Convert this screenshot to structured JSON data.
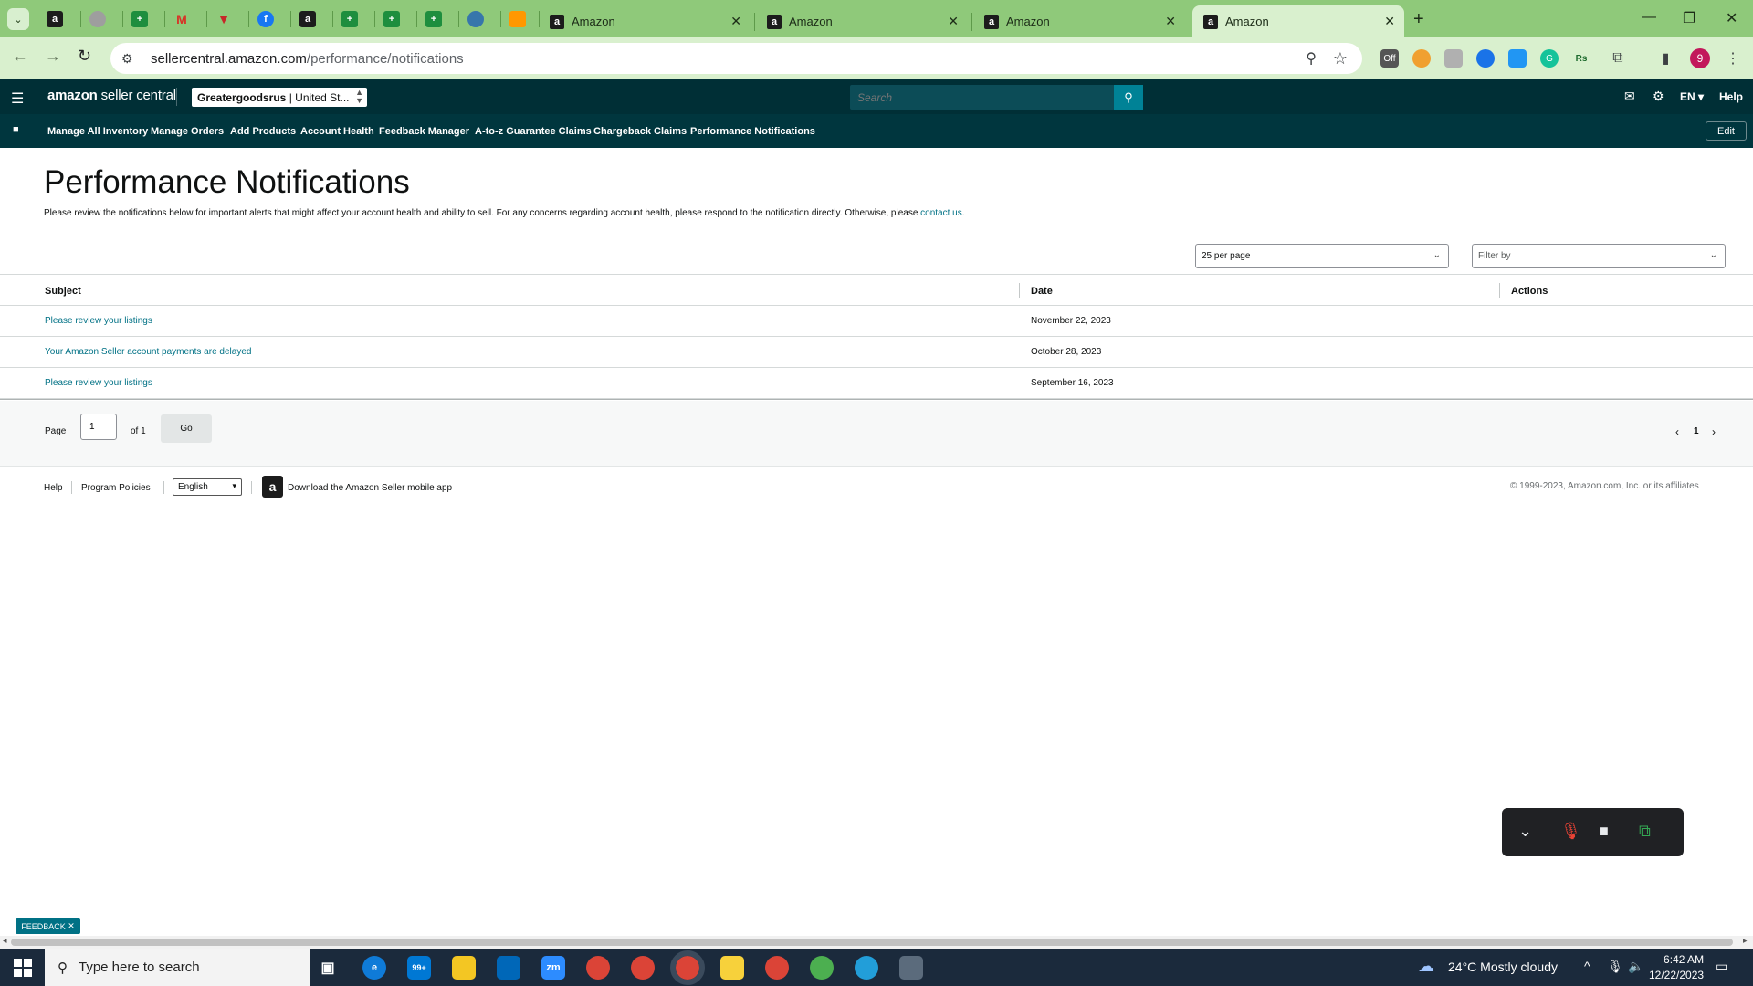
{
  "browser": {
    "tabs": [
      {
        "title": "Amazon"
      },
      {
        "title": "Amazon"
      },
      {
        "title": "Amazon"
      },
      {
        "title": "Amazon",
        "active": true
      }
    ],
    "url_host": "sellercentral.amazon.com",
    "url_path": "/performance/notifications"
  },
  "header": {
    "logo_main": "amazon",
    "logo_sub": "seller central",
    "account_name": "Greatergoodsrus",
    "account_region": "United St...",
    "search_placeholder": "Search",
    "language": "EN",
    "help": "Help"
  },
  "nav": {
    "items": [
      "Manage All Inventory",
      "Manage Orders",
      "Add Products",
      "Account Health",
      "Feedback Manager",
      "A-to-z Guarantee Claims",
      "Chargeback Claims",
      "Performance Notifications"
    ],
    "edit": "Edit"
  },
  "main": {
    "title": "Performance Notifications",
    "intro": "Please review the notifications below for important alerts that might affect your account health and ability to sell. For any concerns regarding account health, please respond to the notification directly. Otherwise, please ",
    "intro_link": "contact us",
    "per_page": "25 per page",
    "filter_placeholder": "Filter by",
    "columns": {
      "subject": "Subject",
      "date": "Date",
      "actions": "Actions"
    },
    "rows": [
      {
        "subject": "Please review your listings",
        "date": "November 22, 2023"
      },
      {
        "subject": "Your Amazon Seller account payments are delayed",
        "date": "October 28, 2023"
      },
      {
        "subject": "Please review your listings",
        "date": "September 16, 2023"
      }
    ],
    "pager": {
      "page_label": "Page",
      "page_value": "1",
      "of_label": "of 1",
      "go": "Go",
      "current": "1"
    }
  },
  "footer": {
    "help": "Help",
    "program_policies": "Program Policies",
    "language": "English",
    "app_text": "Download the Amazon Seller mobile app",
    "copyright": "© 1999-2023, Amazon.com, Inc. or its affiliates"
  },
  "feedback": "FEEDBACK",
  "taskbar": {
    "search_placeholder": "Type here to search",
    "weather": "24°C  Mostly cloudy",
    "time": "6:42 AM",
    "date": "12/22/2023",
    "mail_badge": "99+"
  },
  "colors": {
    "tabstrip": "#8fc97a",
    "header_bg": "#002f36",
    "link": "#007185"
  }
}
